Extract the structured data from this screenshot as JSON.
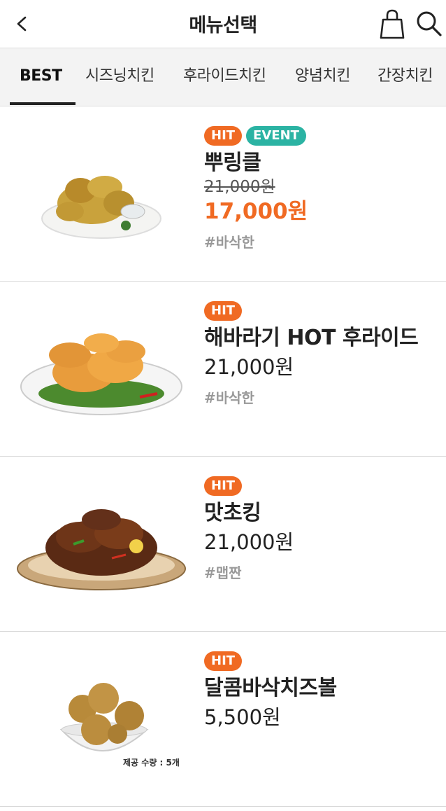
{
  "header": {
    "title": "메뉴선택",
    "back_icon": "chevron-left-icon",
    "bag_icon": "shopping-bag-icon",
    "search_icon": "search-icon"
  },
  "tabs": [
    {
      "label": "BEST",
      "active": true
    },
    {
      "label": "시즈닝치킨",
      "active": false
    },
    {
      "label": "후라이드치킨",
      "active": false
    },
    {
      "label": "양념치킨",
      "active": false
    },
    {
      "label": "간장치킨",
      "active": false
    }
  ],
  "items": [
    {
      "badges": [
        "HIT",
        "EVENT"
      ],
      "name": "뿌링클",
      "original_price": "21,000원",
      "price": "17,000원",
      "tag": "#바삭한"
    },
    {
      "badges": [
        "HIT"
      ],
      "name": "해바라기 HOT 후라이드",
      "price": "21,000원",
      "tag": "#바삭한"
    },
    {
      "badges": [
        "HIT"
      ],
      "name": "맛초킹",
      "price": "21,000원",
      "tag": "#맵짠"
    },
    {
      "badges": [
        "HIT"
      ],
      "name": "달콤바삭치즈볼",
      "price": "5,500원",
      "caption": "제공 수량 : 5개"
    }
  ],
  "colors": {
    "accent": "#f06a23",
    "event": "#2bb3a3",
    "tab_bg": "#f3f3f3"
  }
}
